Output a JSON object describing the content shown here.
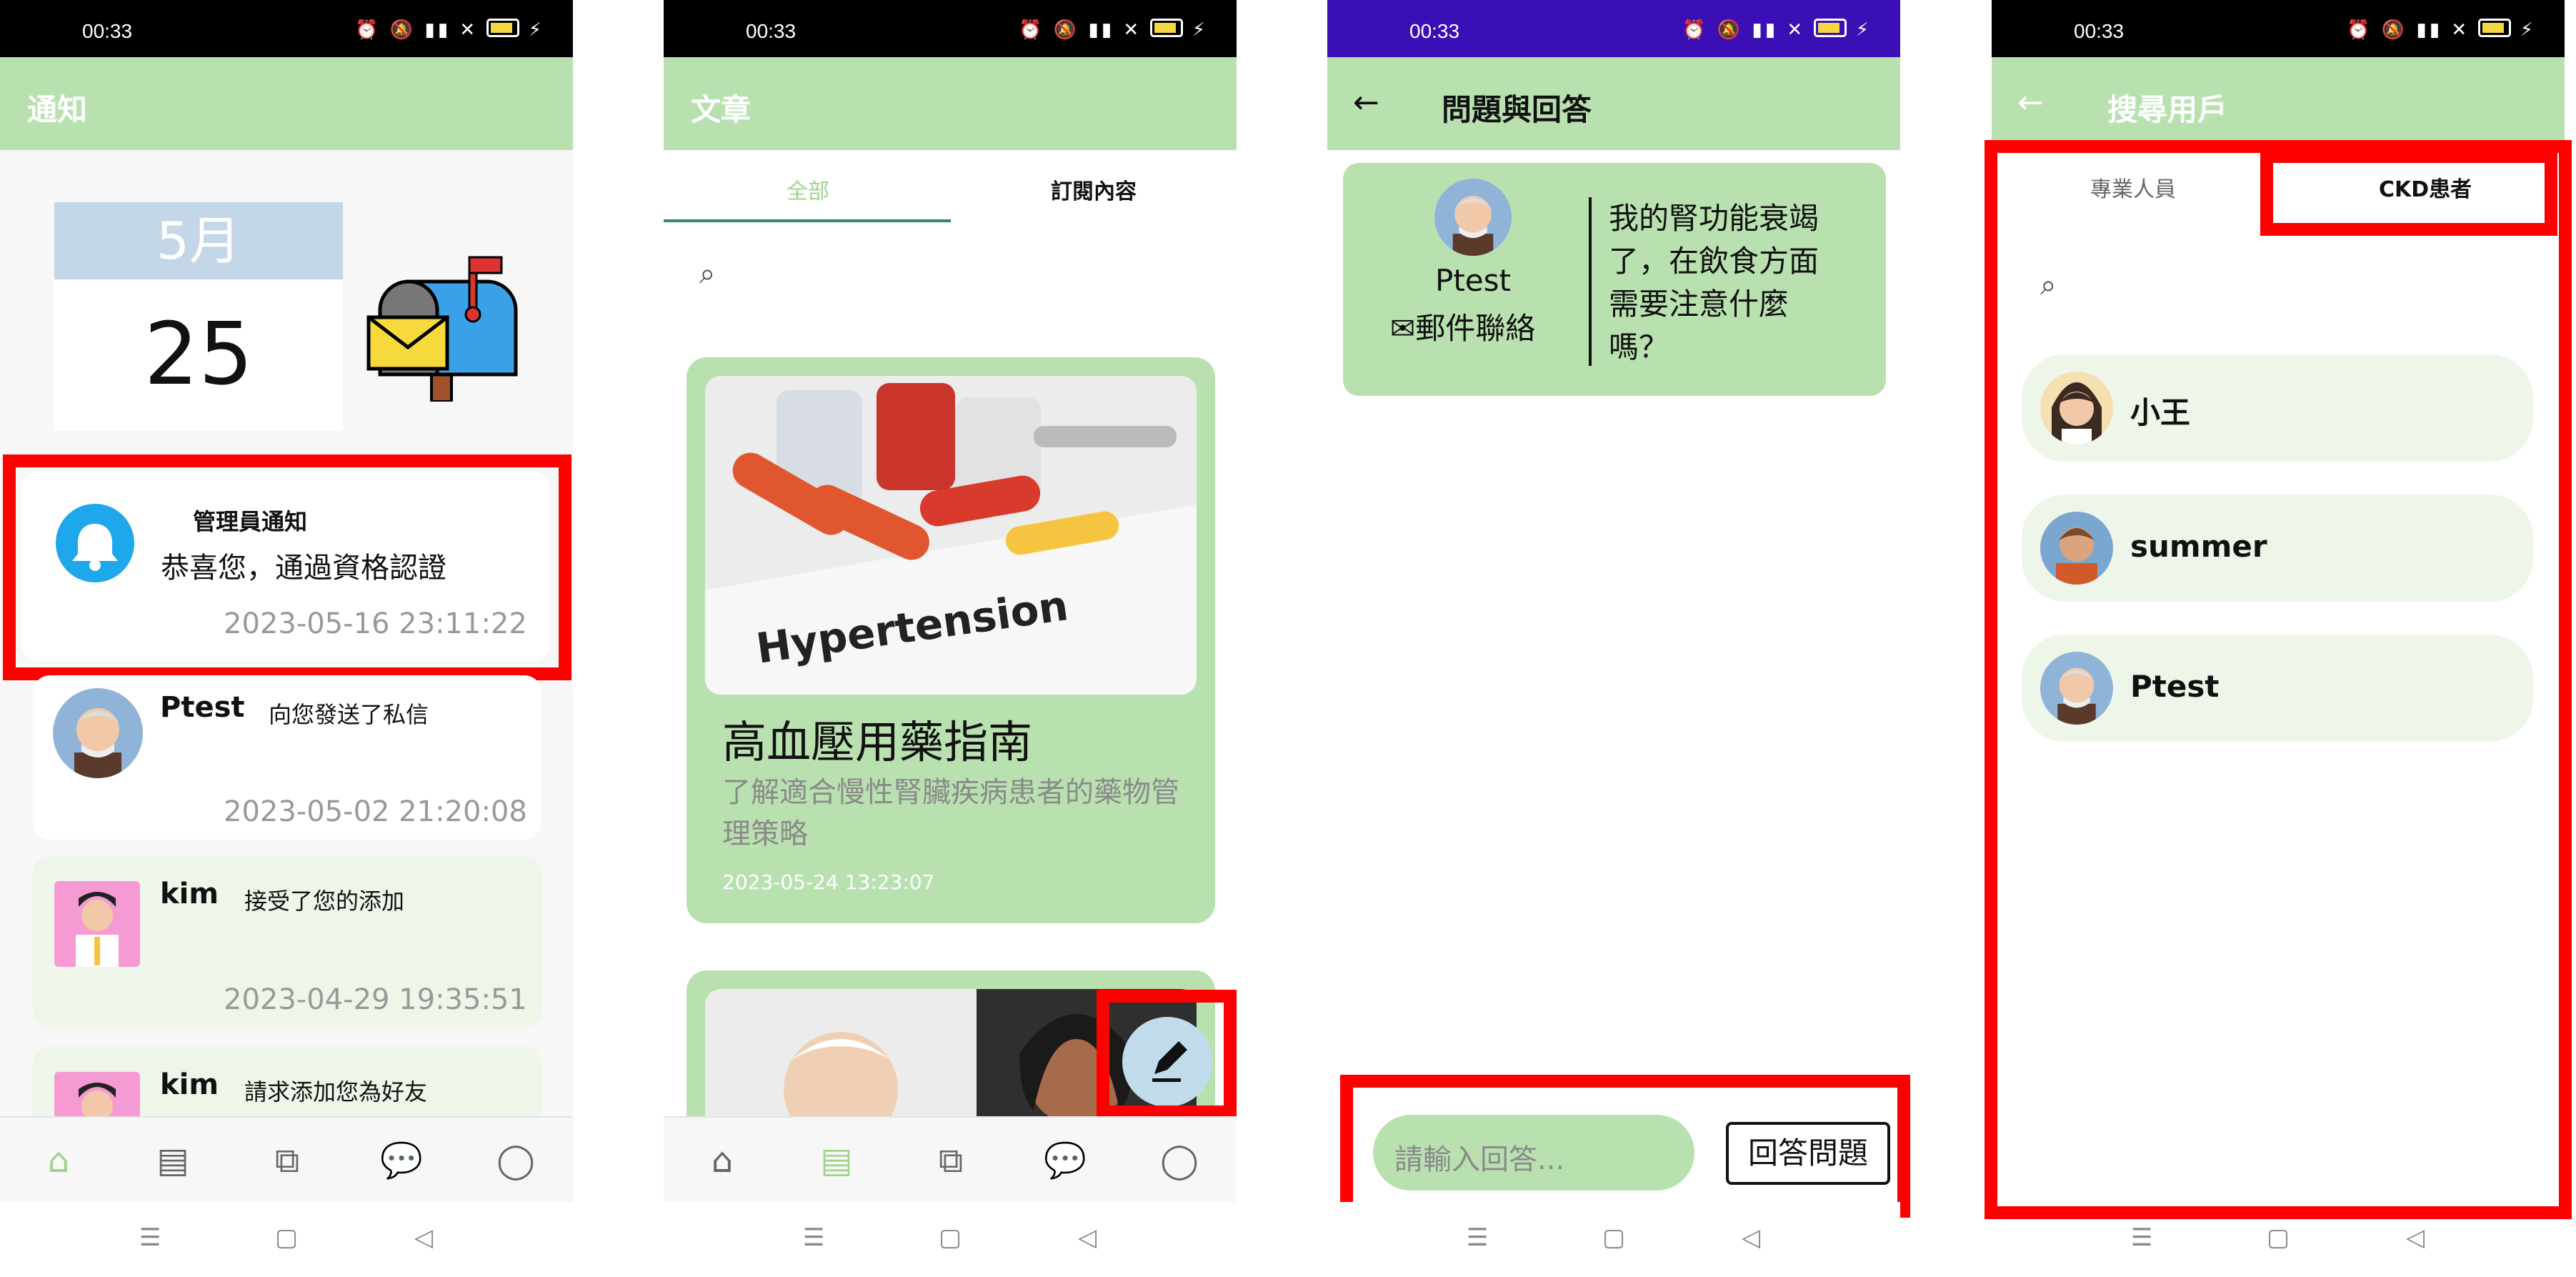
{
  "status": {
    "time": "00:33",
    "icons": "⏰ 🔕 ⁴⁶ ▮ ▯"
  },
  "phone1": {
    "title": "通知",
    "calendar": {
      "month": "5月",
      "day": "25"
    },
    "notifications": [
      {
        "name": "管理員通知",
        "message": "恭喜您，通過資格認證",
        "time": "2023-05-16 23:11:22"
      },
      {
        "name": "Ptest",
        "message": "向您發送了私信",
        "time": "2023-05-02 21:20:08"
      },
      {
        "name": "kim",
        "message": "接受了您的添加",
        "time": "2023-04-29 19:35:51"
      },
      {
        "name": "kim",
        "message": "請求添加您為好友",
        "time": ""
      }
    ]
  },
  "phone2": {
    "title": "文章",
    "tabs": [
      "全部",
      "訂閱內容"
    ],
    "article": {
      "title": "高血壓用藥指南",
      "description": "了解適合慢性腎臟疾病患者的藥物管理策略",
      "date": "2023-05-24 13:23:07",
      "image_text": "Hypertension"
    }
  },
  "phone3": {
    "title": "問題與回答",
    "question": {
      "author": "Ptest",
      "contact": "郵件聯絡",
      "text": "我的腎功能衰竭了，在飲食方面需要注意什麼嗎？"
    },
    "answer_placeholder": "請輸入回答...",
    "answer_button": "回答問題"
  },
  "phone4": {
    "title": "搜尋用戶",
    "tabs": [
      "專業人員",
      "CKD患者"
    ],
    "users": [
      "小王",
      "summer",
      "Ptest"
    ]
  },
  "nav_icons": [
    "home-icon",
    "article-icon",
    "translate-icon",
    "chat-icon",
    "profile-icon"
  ],
  "system_nav": [
    "☰",
    "▢",
    "◁"
  ],
  "colors": {
    "app_green": "#b9e1b0",
    "light_green": "#eef6ea",
    "highlight_red": "#ff0000",
    "bell_blue": "#1ea7ea"
  }
}
